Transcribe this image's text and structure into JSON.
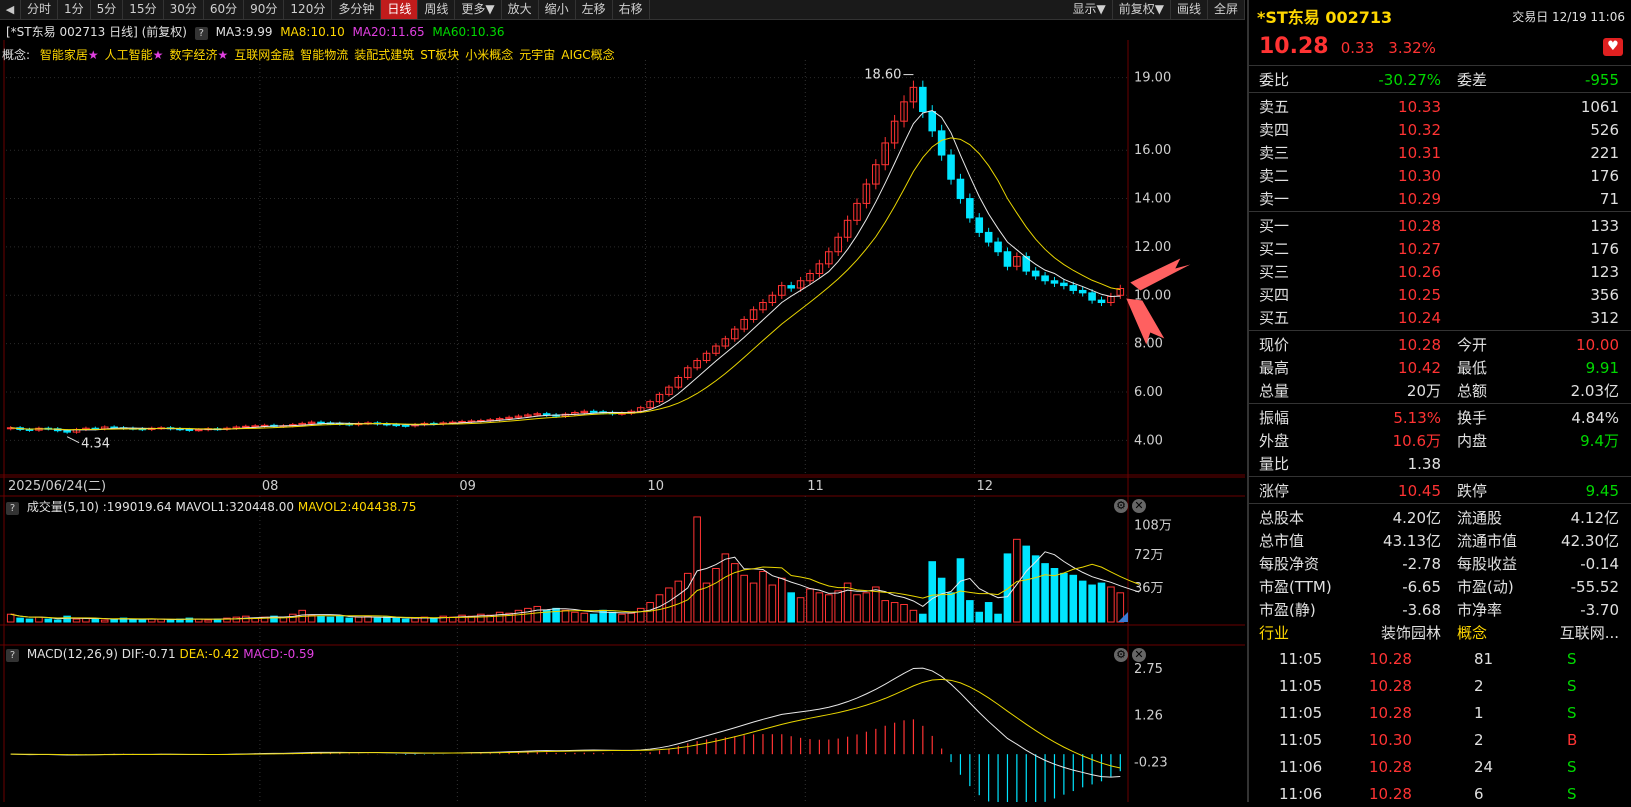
{
  "toolbar": {
    "left_arrow": "◀",
    "items": [
      "分时",
      "1分",
      "5分",
      "15分",
      "30分",
      "60分",
      "90分",
      "120分",
      "多分钟",
      "日线",
      "周线",
      "更多▼",
      "放大",
      "缩小",
      "左移",
      "右移"
    ],
    "active_index": 9,
    "right_items": [
      "显示▼",
      "前复权▼",
      "画线",
      "全屏"
    ]
  },
  "chart_header": {
    "title": "[*ST东易 002713 日线]  (前复权)",
    "q": "?",
    "ma3": "MA3:9.99",
    "ma8": "MA8:10.10",
    "ma20": "MA20:11.65",
    "ma60": "MA60:10.36"
  },
  "concepts": {
    "label": "概念:",
    "items": [
      "智能家居",
      "人工智能",
      "数字经济",
      "互联网金融",
      "智能物流",
      "装配式建筑",
      "ST板块",
      "小米概念",
      "元宇宙",
      "AIGC概念"
    ],
    "starred": [
      true,
      true,
      true,
      false,
      false,
      false,
      false,
      false,
      false,
      false
    ]
  },
  "price_axis": [
    "19.00",
    "16.00",
    "14.00",
    "12.00",
    "10.00",
    "8.00",
    "6.00",
    "4.00"
  ],
  "date_axis": [
    "2025/06/24(二)",
    "08",
    "09",
    "10",
    "11",
    "12"
  ],
  "max_label": "18.60",
  "min_label": "4.34",
  "volume_header": {
    "q": "?",
    "label": "成交量(5,10)",
    "vol": ":199019.64",
    "mavol1": "MAVOL1:320448.00",
    "mavol2": "MAVOL2:404438.75"
  },
  "volume_axis": [
    "108万",
    "72万",
    "36万"
  ],
  "macd_header": {
    "q": "?",
    "label": "MACD(12,26,9)",
    "dif": "DIF:-0.71",
    "dea": "DEA:-0.42",
    "macd": "MACD:-0.59"
  },
  "macd_axis": [
    "2.75",
    "1.26",
    "-0.23"
  ],
  "chart_data": {
    "type": "candlestick",
    "price_axis_ticks": [
      4,
      6,
      8,
      10,
      12,
      14,
      16,
      19
    ],
    "price_range": [
      3.6,
      19.4
    ],
    "volume_range": [
      0,
      110
    ],
    "macd_range": [
      -1.3,
      3.0
    ],
    "months": [
      {
        "label": "2025/06/24(二)",
        "start": 0
      },
      {
        "label": "08",
        "start": 27
      },
      {
        "label": "09",
        "start": 48
      },
      {
        "label": "10",
        "start": 68
      },
      {
        "label": "11",
        "start": 85
      },
      {
        "label": "12",
        "start": 103
      }
    ],
    "close": [
      4.52,
      4.45,
      4.42,
      4.5,
      4.48,
      4.4,
      4.34,
      4.45,
      4.5,
      4.48,
      4.55,
      4.52,
      4.5,
      4.48,
      4.45,
      4.5,
      4.52,
      4.48,
      4.45,
      4.42,
      4.44,
      4.48,
      4.46,
      4.5,
      4.55,
      4.58,
      4.6,
      4.62,
      4.58,
      4.6,
      4.65,
      4.7,
      4.75,
      4.72,
      4.7,
      4.68,
      4.65,
      4.7,
      4.72,
      4.68,
      4.65,
      4.62,
      4.6,
      4.65,
      4.7,
      4.68,
      4.72,
      4.75,
      4.78,
      4.8,
      4.82,
      4.85,
      4.9,
      4.95,
      5.0,
      5.05,
      5.1,
      5.05,
      5.0,
      5.08,
      5.15,
      5.2,
      5.18,
      5.15,
      5.1,
      5.12,
      5.2,
      5.35,
      5.6,
      5.9,
      6.2,
      6.6,
      7.0,
      7.3,
      7.6,
      7.9,
      8.2,
      8.6,
      9.0,
      9.4,
      9.7,
      10.0,
      10.4,
      10.3,
      10.6,
      10.9,
      11.3,
      11.8,
      12.4,
      13.1,
      13.8,
      14.6,
      15.4,
      16.3,
      17.2,
      18.0,
      18.6,
      17.6,
      16.8,
      15.8,
      14.8,
      14.0,
      13.2,
      12.6,
      12.2,
      11.8,
      11.2,
      11.6,
      11.0,
      10.8,
      10.6,
      10.5,
      10.4,
      10.2,
      10.1,
      9.8,
      9.7,
      9.95,
      10.28
    ],
    "open": [
      4.48,
      4.52,
      4.45,
      4.42,
      4.5,
      4.48,
      4.4,
      4.34,
      4.45,
      4.5,
      4.48,
      4.55,
      4.52,
      4.5,
      4.48,
      4.45,
      4.5,
      4.52,
      4.48,
      4.45,
      4.42,
      4.44,
      4.48,
      4.46,
      4.5,
      4.55,
      4.58,
      4.6,
      4.62,
      4.58,
      4.6,
      4.65,
      4.7,
      4.75,
      4.72,
      4.7,
      4.68,
      4.65,
      4.7,
      4.72,
      4.68,
      4.65,
      4.62,
      4.6,
      4.65,
      4.7,
      4.68,
      4.72,
      4.75,
      4.78,
      4.8,
      4.82,
      4.85,
      4.9,
      4.95,
      5.0,
      5.05,
      5.1,
      5.05,
      5.0,
      5.08,
      5.15,
      5.2,
      5.18,
      5.15,
      5.1,
      5.12,
      5.2,
      5.35,
      5.6,
      5.9,
      6.2,
      6.6,
      7.0,
      7.3,
      7.6,
      7.9,
      8.2,
      8.6,
      9.0,
      9.4,
      9.7,
      10.0,
      10.4,
      10.3,
      10.6,
      10.9,
      11.3,
      11.8,
      12.4,
      13.1,
      13.8,
      14.6,
      15.4,
      16.3,
      17.2,
      18.0,
      18.6,
      17.6,
      16.8,
      15.8,
      14.8,
      14.0,
      13.2,
      12.6,
      12.2,
      11.8,
      11.2,
      11.6,
      11.0,
      10.8,
      10.6,
      10.5,
      10.4,
      10.2,
      10.1,
      9.8,
      9.7,
      10.0
    ],
    "volume": [
      8,
      4,
      3,
      5,
      3,
      2,
      6,
      3,
      4,
      3,
      2,
      3,
      4,
      3,
      2,
      3,
      3,
      2,
      3,
      4,
      3,
      2,
      3,
      4,
      5,
      6,
      4,
      5,
      6,
      5,
      8,
      12,
      7,
      6,
      5,
      6,
      4,
      5,
      6,
      4,
      5,
      4,
      3,
      4,
      5,
      4,
      6,
      5,
      7,
      6,
      8,
      7,
      10,
      9,
      12,
      14,
      16,
      12,
      14,
      12,
      10,
      9,
      8,
      12,
      10,
      8,
      9,
      14,
      20,
      28,
      35,
      42,
      50,
      108,
      40,
      55,
      70,
      60,
      48,
      40,
      52,
      38,
      45,
      30,
      25,
      34,
      30,
      28,
      32,
      40,
      28,
      30,
      36,
      22,
      20,
      18,
      12,
      8,
      62,
      45,
      30,
      65,
      22,
      10,
      20,
      8,
      70,
      85,
      78,
      68,
      60,
      55,
      50,
      48,
      42,
      38,
      40,
      36,
      30,
      26,
      22
    ],
    "ma_price": {
      "MA3": 9.99,
      "MA8": 10.1,
      "MA20": 11.65,
      "MA60": 10.36
    },
    "macd_summary": {
      "DIF": -0.71,
      "DEA": -0.42,
      "MACD": -0.59
    },
    "colors": {
      "up": "#ff3333",
      "down": "#00e5ff",
      "ma_white": "#e8e8e8",
      "ma_yellow": "#e8d500"
    }
  },
  "quote": {
    "name": "*ST东易",
    "code": "002713",
    "time": "交易日 12/19 11:06",
    "price": "10.28",
    "change": "0.33",
    "pct": "3.32%",
    "weibi_label": "委比",
    "weibi": "-30.27%",
    "weicha_label": "委差",
    "weicha": "-955",
    "asks": [
      {
        "label": "卖五",
        "price": "10.33",
        "vol": "1061"
      },
      {
        "label": "卖四",
        "price": "10.32",
        "vol": "526"
      },
      {
        "label": "卖三",
        "price": "10.31",
        "vol": "221"
      },
      {
        "label": "卖二",
        "price": "10.30",
        "vol": "176"
      },
      {
        "label": "卖一",
        "price": "10.29",
        "vol": "71"
      }
    ],
    "bids": [
      {
        "label": "买一",
        "price": "10.28",
        "vol": "133"
      },
      {
        "label": "买二",
        "price": "10.27",
        "vol": "176"
      },
      {
        "label": "买三",
        "price": "10.26",
        "vol": "123"
      },
      {
        "label": "买四",
        "price": "10.25",
        "vol": "356"
      },
      {
        "label": "买五",
        "price": "10.24",
        "vol": "312"
      }
    ],
    "stats": [
      {
        "l1": "现价",
        "v1": "10.28",
        "c1": "red",
        "l2": "今开",
        "v2": "10.00",
        "c2": "red"
      },
      {
        "l1": "最高",
        "v1": "10.42",
        "c1": "red",
        "l2": "最低",
        "v2": "9.91",
        "c2": "green"
      },
      {
        "l1": "总量",
        "v1": "20万",
        "c1": "white",
        "l2": "总额",
        "v2": "2.03亿",
        "c2": "white"
      },
      {
        "l1": "振幅",
        "v1": "5.13%",
        "c1": "red",
        "l2": "换手",
        "v2": "4.84%",
        "c2": "white"
      },
      {
        "l1": "外盘",
        "v1": "10.6万",
        "c1": "red",
        "l2": "内盘",
        "v2": "9.4万",
        "c2": "green"
      },
      {
        "l1": "量比",
        "v1": "1.38",
        "c1": "white",
        "l2": "",
        "v2": "",
        "c2": "white"
      }
    ],
    "limits": {
      "l1": "涨停",
      "v1": "10.45",
      "l2": "跌停",
      "v2": "9.45"
    },
    "fundamentals": [
      {
        "l1": "总股本",
        "v1": "4.20亿",
        "l2": "流通股",
        "v2": "4.12亿"
      },
      {
        "l1": "总市值",
        "v1": "43.13亿",
        "l2": "流通市值",
        "v2": "42.30亿"
      },
      {
        "l1": "每股净资",
        "v1": "-2.78",
        "l2": "每股收益",
        "v2": "-0.14"
      },
      {
        "l1": "市盈(TTM)",
        "v1": "-6.65",
        "l2": "市盈(动)",
        "v2": "-55.52"
      },
      {
        "l1": "市盈(静)",
        "v1": "-3.68",
        "l2": "市净率",
        "v2": "-3.70"
      }
    ],
    "industry": {
      "l1": "行业",
      "v1": "装饰园林",
      "l2": "概念",
      "v2": "互联网..."
    },
    "ticks": [
      {
        "time": "11:05",
        "price": "10.28",
        "vol": "81",
        "side": "S"
      },
      {
        "time": "11:05",
        "price": "10.28",
        "vol": "2",
        "side": "S"
      },
      {
        "time": "11:05",
        "price": "10.28",
        "vol": "1",
        "side": "S"
      },
      {
        "time": "11:05",
        "price": "10.30",
        "vol": "2",
        "side": "B"
      },
      {
        "time": "11:06",
        "price": "10.28",
        "vol": "24",
        "side": "S"
      },
      {
        "time": "11:06",
        "price": "10.28",
        "vol": "6",
        "side": "S"
      }
    ]
  }
}
